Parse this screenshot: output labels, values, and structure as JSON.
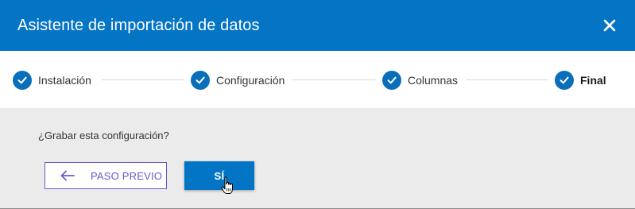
{
  "header": {
    "title": "Asistente de importación de datos",
    "close_icon": "close-icon"
  },
  "steps": [
    {
      "label": "Instalación",
      "completed": true,
      "current": false
    },
    {
      "label": "Configuración",
      "completed": true,
      "current": false
    },
    {
      "label": "Columnas",
      "completed": true,
      "current": false
    },
    {
      "label": "Final",
      "completed": true,
      "current": true
    }
  ],
  "body": {
    "question": "¿Grabar esta configuración?",
    "back_button_label": "PASO PREVIO",
    "yes_button_label": "SÍ"
  },
  "colors": {
    "header_bg": "#0474c4",
    "step_check": "#0a6fba",
    "back_button_accent": "#6a5acd",
    "body_bg": "#ebebeb"
  }
}
